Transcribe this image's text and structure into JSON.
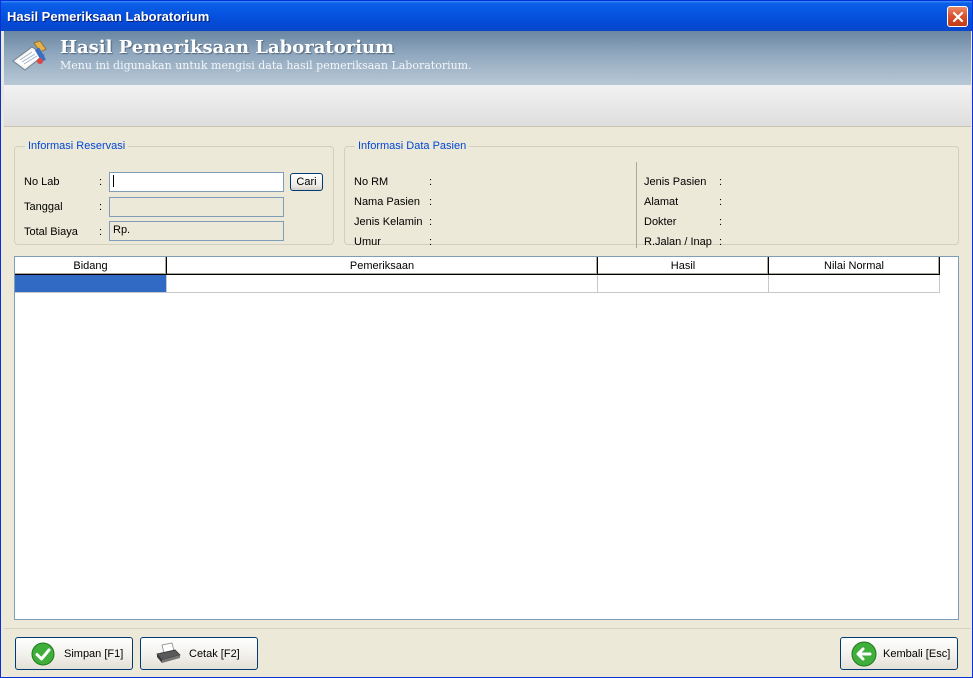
{
  "window": {
    "title": "Hasil Pemeriksaan Laboratorium"
  },
  "header": {
    "title": "Hasil Pemeriksaan Laboratorium",
    "subtitle": "Menu ini digunakan untuk mengisi data hasil pemeriksaan Laboratorium.",
    "icon": "lab-form-icon"
  },
  "reservasi": {
    "legend": "Informasi Reservasi",
    "no_lab_label": "No Lab",
    "no_lab_value": "",
    "tanggal_label": "Tanggal",
    "tanggal_value": "",
    "total_biaya_label": "Total Biaya",
    "total_biaya_value": "Rp.",
    "colon": ":",
    "cari_label": "Cari"
  },
  "pasien": {
    "legend": "Informasi Data Pasien",
    "no_rm_label": "No RM",
    "nama_label": "Nama Pasien",
    "jk_label": "Jenis Kelamin",
    "umur_label": "Umur",
    "jenis_label": "Jenis Pasien",
    "alamat_label": "Alamat",
    "dokter_label": "Dokter",
    "rawat_label": "R.Jalan / Inap",
    "colon": ":"
  },
  "grid": {
    "columns": [
      "Bidang",
      "Pemeriksaan",
      "Hasil",
      "Nilai Normal"
    ]
  },
  "buttons": {
    "simpan": "Simpan [F1]",
    "cetak": "Cetak [F2]",
    "kembali": "Kembali [Esc]"
  },
  "colors": {
    "titlebar": "#0653e0",
    "legend": "#0046d5",
    "selection": "#316ac5"
  }
}
